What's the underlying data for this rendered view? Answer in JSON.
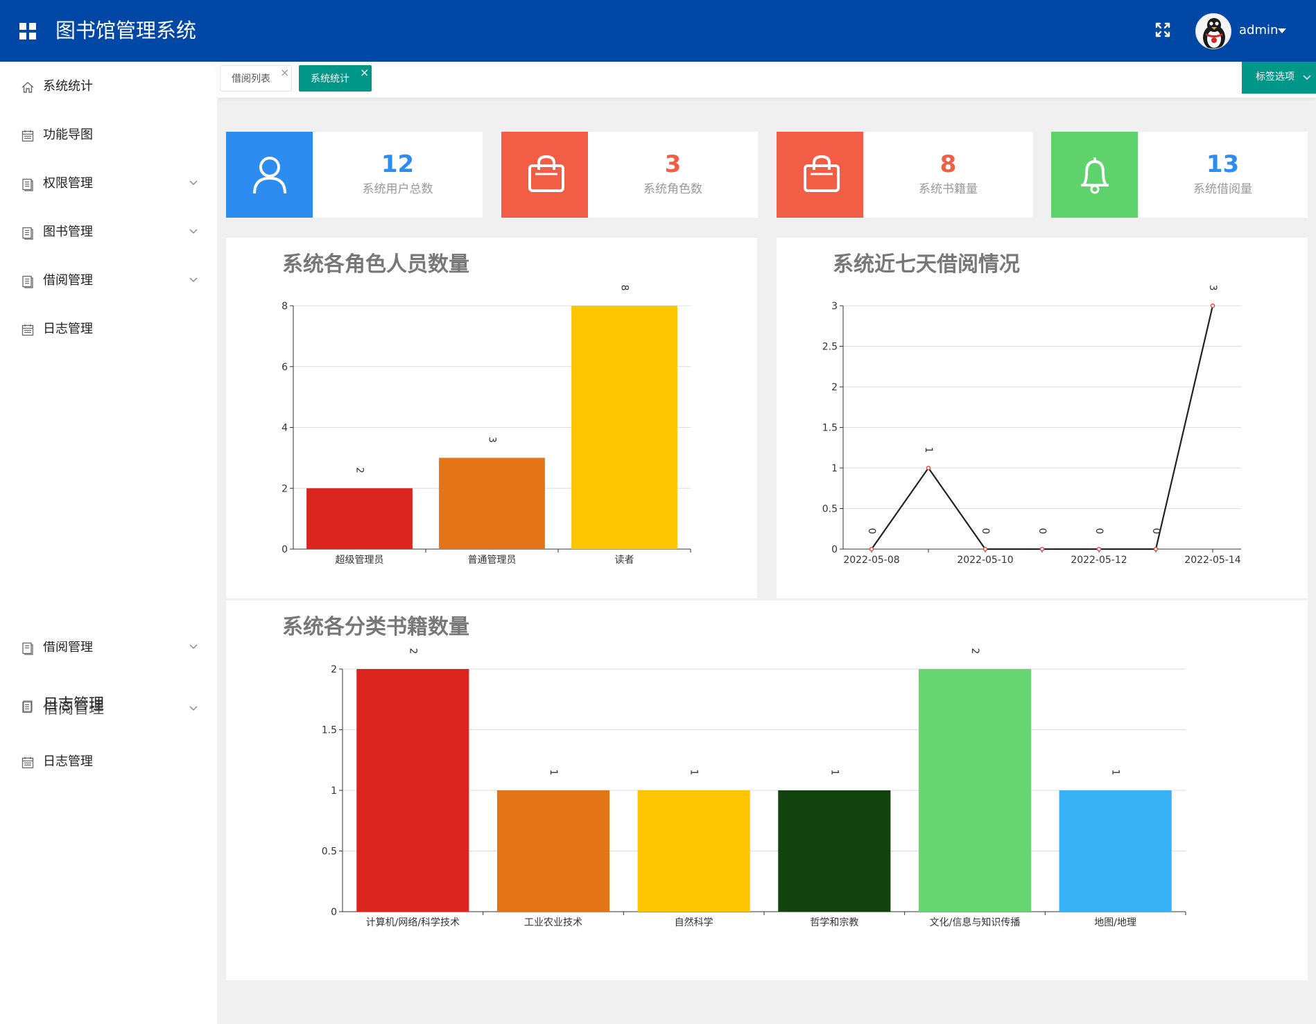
{
  "header": {
    "title": "图书馆管理系统",
    "user_name": "admin"
  },
  "sidebar": {
    "items": [
      {
        "label": "系统统计",
        "icon": "home-icon",
        "expandable": false
      },
      {
        "label": "功能导图",
        "icon": "calendar-icon",
        "expandable": false
      },
      {
        "label": "权限管理",
        "icon": "document-icon",
        "expandable": true
      },
      {
        "label": "图书管理",
        "icon": "document-icon",
        "expandable": true
      },
      {
        "label": "借阅管理",
        "icon": "document-icon",
        "expandable": true
      },
      {
        "label": "日志管理",
        "icon": "calendar-icon",
        "expandable": false
      }
    ],
    "ghost_items": [
      {
        "label": "借阅管理",
        "icon": "document-icon",
        "expandable": true
      },
      {
        "label": "日志管理",
        "overlay_label": "借阅管理",
        "icon": "document-icon",
        "expandable": true
      },
      {
        "label": "日志管理",
        "icon": "calendar-icon",
        "expandable": false
      }
    ]
  },
  "tabs": {
    "items": [
      {
        "label": "借阅列表",
        "active": false
      },
      {
        "label": "系统统计",
        "active": true
      }
    ],
    "options_label": "标签选项"
  },
  "stats": [
    {
      "value": "12",
      "label": "系统用户总数",
      "color": "#2d8cf0",
      "icon": "user-icon"
    },
    {
      "value": "3",
      "label": "系统角色数",
      "color": "#f25e45",
      "icon": "shopping-bag-icon"
    },
    {
      "value": "8",
      "label": "系统书籍量",
      "color": "#f25e45",
      "icon": "shopping-bag-icon"
    },
    {
      "value": "13",
      "label": "系统借阅量",
      "color": "#5fd36b",
      "icon": "bell-icon"
    }
  ],
  "chart_data": [
    {
      "type": "bar",
      "title": "系统各角色人员数量",
      "categories": [
        "超级管理员",
        "普通管理员",
        "读者"
      ],
      "values": [
        2,
        3,
        8
      ],
      "colors": [
        "#dc241e",
        "#e37518",
        "#fcc500"
      ],
      "ylim": [
        0,
        8
      ],
      "yticks": [
        "0",
        "2",
        "4",
        "6",
        "8"
      ],
      "data_labels": [
        "2",
        "3",
        "8"
      ],
      "grid": true
    },
    {
      "type": "line",
      "title": "系统近七天借阅情况",
      "x": [
        "2022-05-08",
        "2022-05-09",
        "2022-05-10",
        "2022-05-11",
        "2022-05-12",
        "2022-05-13",
        "2022-05-14"
      ],
      "xtick_labels": [
        "2022-05-08",
        "2022-05-10",
        "2022-05-12",
        "2022-05-14"
      ],
      "values": [
        0,
        1,
        0,
        0,
        0,
        0,
        3
      ],
      "data_labels": [
        "0",
        "1",
        "0",
        "0",
        "0",
        "0",
        "3"
      ],
      "ylim": [
        0,
        3
      ],
      "yticks": [
        "0",
        "0.5",
        "1",
        "1.5",
        "2",
        "2.5",
        "3"
      ],
      "line_color": "#222222",
      "marker_color": "#e04a4a",
      "grid": true
    },
    {
      "type": "bar",
      "title": "系统各分类书籍数量",
      "categories": [
        "计算机/网络/科学技术",
        "工业农业技术",
        "自然科学",
        "哲学和宗教",
        "文化/信息与知识传播",
        "地图/地理"
      ],
      "values": [
        2,
        1,
        1,
        1,
        2,
        1
      ],
      "colors": [
        "#dc241e",
        "#e37518",
        "#fcc500",
        "#12430f",
        "#66d572",
        "#38b0f4"
      ],
      "ylim": [
        0,
        2
      ],
      "yticks": [
        "0",
        "0.5",
        "1",
        "1.5",
        "2"
      ],
      "data_labels": [
        "2",
        "1",
        "1",
        "1",
        "2",
        "1"
      ],
      "grid": true
    }
  ]
}
